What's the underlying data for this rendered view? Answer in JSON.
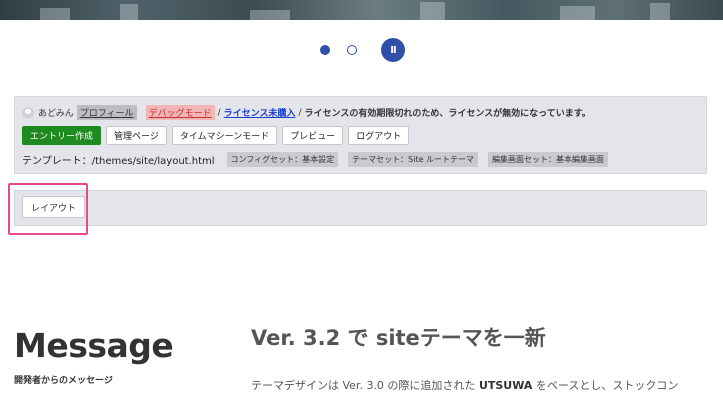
{
  "slider": {
    "pause_label": "II"
  },
  "admin": {
    "user_name": "あどみん",
    "profile_label": "プロフィール",
    "debug_label": "デバッグモード",
    "sep1": "/",
    "license_label": "ライセンス未購入",
    "sep2": "/",
    "license_message": "ライセンスの有効期限切れのため、ライセンスが無効になっています。",
    "buttons": {
      "entry": "エントリー作成",
      "admin_page": "管理ページ",
      "timemachine": "タイムマシーンモード",
      "preview": "プレビュー",
      "logout": "ログアウト"
    },
    "template_text": "テンプレート：/themes/site/layout.html",
    "tags": [
      "コンフィグセット：基本設定",
      "テーマセット：Site ルートテーマ",
      "編集画面セット：基本編集画面"
    ]
  },
  "layout": {
    "button_label": "レイアウト"
  },
  "message": {
    "title": "Message",
    "subtitle": "開発者からのメッセージ"
  },
  "news": {
    "title": "Ver. 3.2 で siteテーマを一新",
    "body_prefix": "テーマデザインは Ver. 3.0 の際に追加された ",
    "body_bold": "UTSUWA",
    "body_suffix": " をベースとし、ストックコン"
  },
  "colors": {
    "accent": "#2f4fa8",
    "entry_button": "#1f8a1f",
    "highlight_frame": "#e8488f",
    "license_link": "#1a3fd0"
  }
}
